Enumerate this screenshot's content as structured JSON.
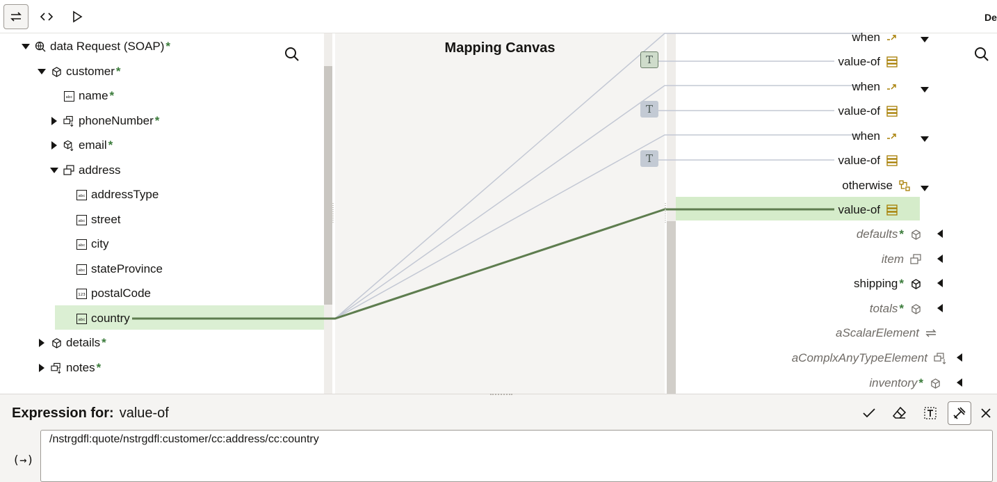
{
  "toolbar": {
    "right_text": "De"
  },
  "canvas": {
    "title": "Mapping Canvas"
  },
  "source_tree": [
    {
      "label": "data Request (SOAP)",
      "required": "*"
    },
    {
      "label": "customer",
      "required": "*"
    },
    {
      "label": "name",
      "required": "*"
    },
    {
      "label": "phoneNumber",
      "required": "*"
    },
    {
      "label": "email",
      "required": "*"
    },
    {
      "label": "address",
      "required": ""
    },
    {
      "label": "addressType",
      "required": ""
    },
    {
      "label": "street",
      "required": ""
    },
    {
      "label": "city",
      "required": ""
    },
    {
      "label": "stateProvince",
      "required": ""
    },
    {
      "label": "postalCode",
      "required": ""
    },
    {
      "label": "country",
      "required": ""
    },
    {
      "label": "details",
      "required": "*"
    },
    {
      "label": "notes",
      "required": "*"
    }
  ],
  "target_tree": [
    {
      "label": "when",
      "required": ""
    },
    {
      "label": "value-of",
      "required": ""
    },
    {
      "label": "when",
      "required": ""
    },
    {
      "label": "value-of",
      "required": ""
    },
    {
      "label": "when",
      "required": ""
    },
    {
      "label": "value-of",
      "required": ""
    },
    {
      "label": "otherwise",
      "required": ""
    },
    {
      "label": "value-of",
      "required": ""
    },
    {
      "label": "defaults",
      "required": "*"
    },
    {
      "label": "item",
      "required": ""
    },
    {
      "label": "shipping",
      "required": "*"
    },
    {
      "label": "totals",
      "required": "*"
    },
    {
      "label": "aScalarElement",
      "required": ""
    },
    {
      "label": "aComplxAnyTypeElement",
      "required": ""
    },
    {
      "label": "inventory",
      "required": "*"
    }
  ],
  "function_boxes": [
    "T",
    "T",
    "T"
  ],
  "expression": {
    "label": "Expression for:",
    "target": "value-of",
    "value": "/nstrgdfl:quote/nstrgdfl:customer/cc:address/cc:country",
    "side_symbol": "(→)"
  },
  "colors": {
    "accent_green": "#5e7d4f",
    "highlight": "#dbefd3",
    "gold": "#a67d00",
    "line_gray": "#c3c8d4"
  }
}
